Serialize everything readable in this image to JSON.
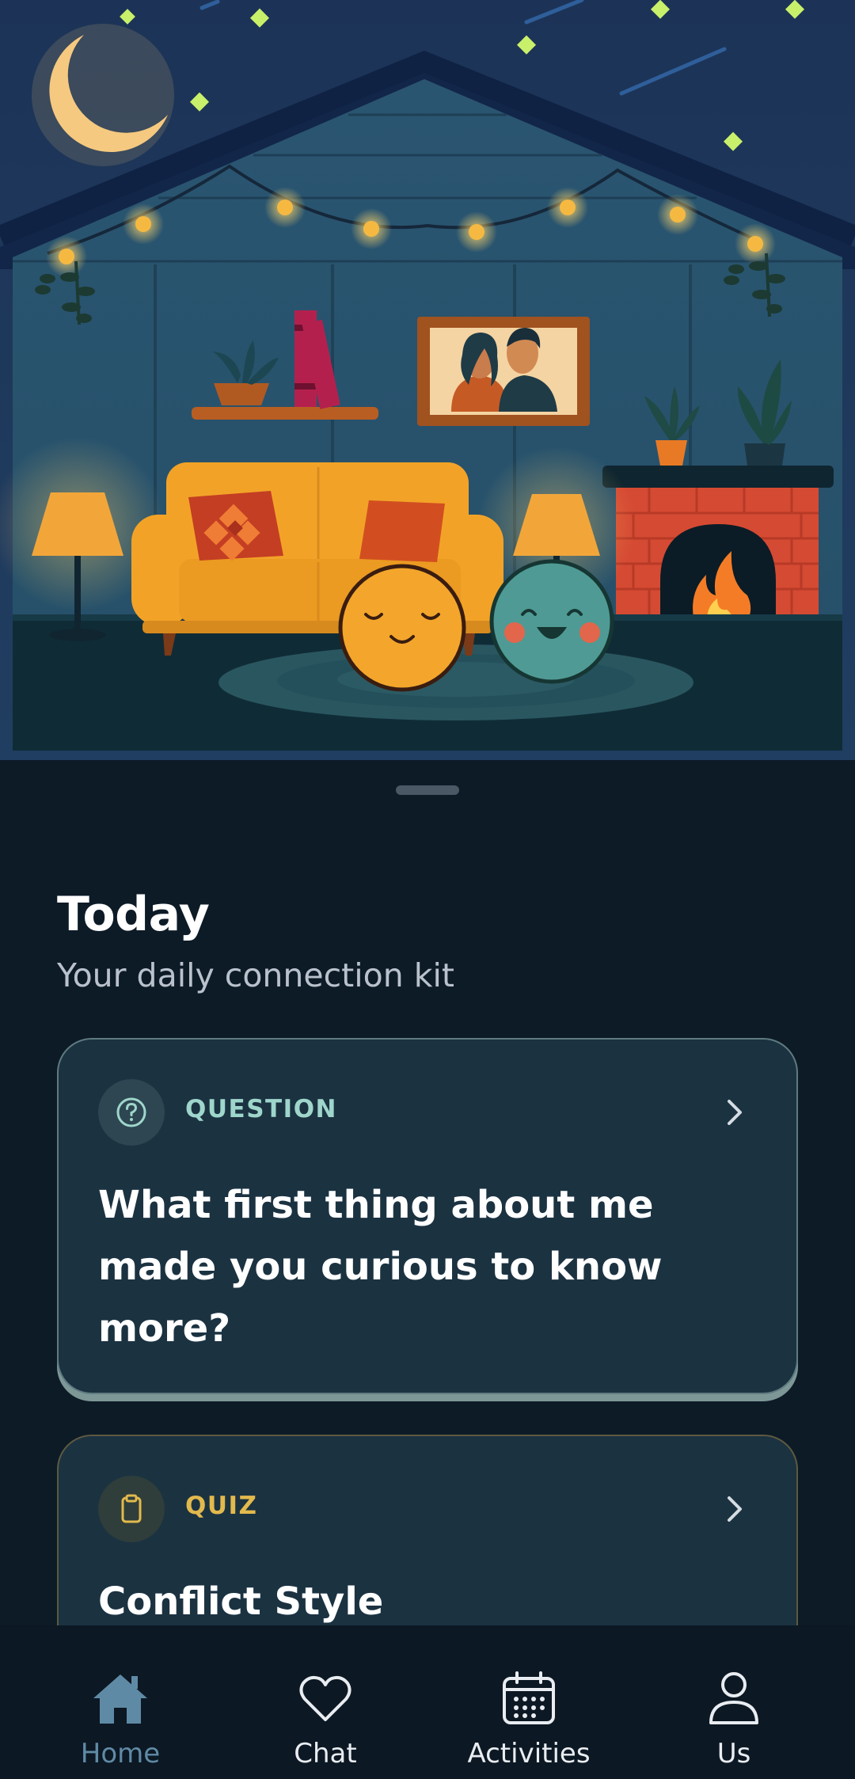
{
  "header": {
    "title": "Today",
    "subtitle": "Your daily connection kit"
  },
  "cards": [
    {
      "kind": "QUESTION",
      "icon": "question-circle-icon",
      "text": "What first thing about me made you curious to know more?",
      "accent": "#9fd6cc"
    },
    {
      "kind": "QUIZ",
      "icon": "clipboard-icon",
      "text": "Conflict Style",
      "accent": "#e2b94d"
    }
  ],
  "nav": {
    "items": [
      {
        "label": "Home",
        "icon": "home-icon",
        "active": true
      },
      {
        "label": "Chat",
        "icon": "heart-icon",
        "active": false
      },
      {
        "label": "Activities",
        "icon": "calendar-icon",
        "active": false
      },
      {
        "label": "Us",
        "icon": "person-icon",
        "active": false
      }
    ]
  },
  "colors": {
    "background": "#0d1b27",
    "card": "#1b3241",
    "nav_active": "#5f8aa6",
    "sofa": "#f2a327",
    "partner_a": "#f3a62b",
    "partner_b": "#4f9a94"
  }
}
